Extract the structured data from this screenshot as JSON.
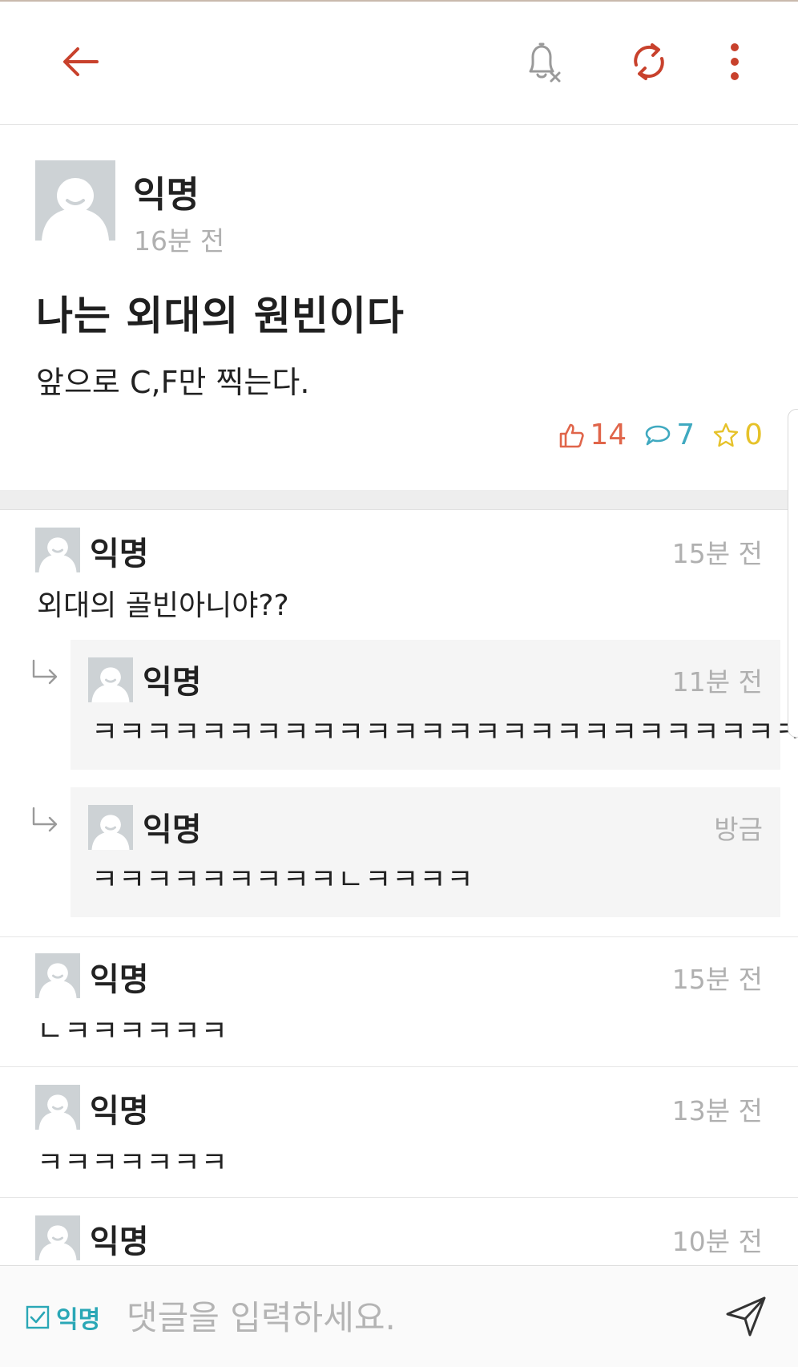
{
  "header": {
    "back_icon": "back-arrow-icon",
    "notification_icon": "bell-off-icon",
    "refresh_icon": "refresh-icon",
    "more_icon": "more-vertical-icon",
    "accent_color": "#c8412c"
  },
  "post": {
    "author": "익명",
    "time": "16분 전",
    "title": "나는 외대의 원빈이다",
    "body": "앞으로 C,F만 찍는다.",
    "likes": "14",
    "comments": "7",
    "scraps": "0",
    "like_color": "#e0654a",
    "comment_color": "#3fa9c0",
    "scrap_color": "#e6c229"
  },
  "comments": [
    {
      "author": "익명",
      "time": "15분 전",
      "text": "외대의 골빈아니야??",
      "replies": [
        {
          "author": "익명",
          "time": "11분 전",
          "text": "ㅋㅋㅋㅋㅋㅋㅋㅋㅋㅋㅋㅋㅋㅋㅋㅋㅋㅋㅋㅋㅋㅋㅋㅋㅋㅋㅋ"
        },
        {
          "author": "익명",
          "time": "방금",
          "text": "ㅋㅋㅋㅋㅋㅋㅋㅋㅋㄴㅋㅋㅋㅋ"
        }
      ]
    },
    {
      "author": "익명",
      "time": "15분 전",
      "text": "ㄴㅋㅋㅋㅋㅋㅋ"
    },
    {
      "author": "익명",
      "time": "13분 전",
      "text": "ㅋㅋㅋㅋㅋㅋㅋ"
    },
    {
      "author": "익명",
      "time": "10분 전",
      "text": ""
    }
  ],
  "input_bar": {
    "anonymous_label": "익명",
    "anonymous_checked": true,
    "placeholder": "댓글을 입력하세요.",
    "send_icon": "send-icon"
  }
}
